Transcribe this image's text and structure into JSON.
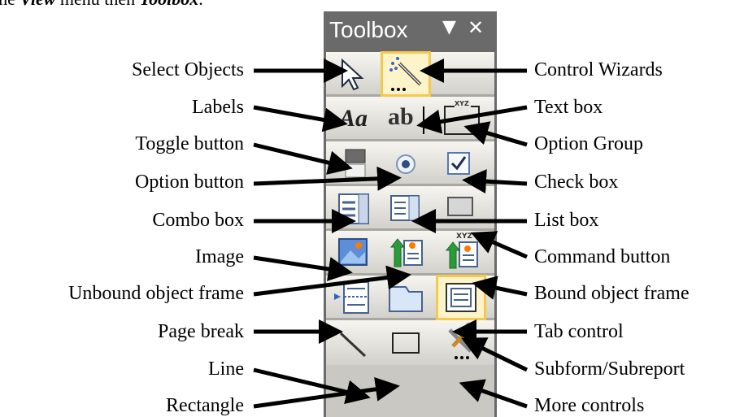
{
  "intro": {
    "text_prefix": "the ",
    "view_word": "View",
    "text_middle": " menu then ",
    "toolbox_word": "Toolbox",
    "text_suffix": "."
  },
  "toolbox": {
    "title": "Toolbox",
    "menu_glyph": "▼",
    "close_glyph": "✕"
  },
  "tools": [
    {
      "id": "select-objects",
      "label": "Select Objects"
    },
    {
      "id": "control-wizards",
      "label": "Control Wizards"
    },
    {
      "id": "labels",
      "label": "Labels",
      "glyph": "Aa"
    },
    {
      "id": "text-box",
      "label": "Text box",
      "glyph": "ab"
    },
    {
      "id": "option-group",
      "label": "Option Group",
      "glyph": "XYZ"
    },
    {
      "id": "toggle-button",
      "label": "Toggle button"
    },
    {
      "id": "option-button",
      "label": "Option button"
    },
    {
      "id": "check-box",
      "label": "Check box"
    },
    {
      "id": "combo-box",
      "label": "Combo box"
    },
    {
      "id": "list-box",
      "label": "List box"
    },
    {
      "id": "command-button",
      "label": "Command button"
    },
    {
      "id": "image",
      "label": "Image"
    },
    {
      "id": "unbound-object-frame",
      "label": "Unbound object frame"
    },
    {
      "id": "bound-object-frame",
      "label": "Bound object frame",
      "glyph": "XYZ"
    },
    {
      "id": "page-break",
      "label": "Page break"
    },
    {
      "id": "tab-control",
      "label": "Tab control"
    },
    {
      "id": "subform-subreport",
      "label": "Subform/Subreport"
    },
    {
      "id": "line",
      "label": "Line"
    },
    {
      "id": "rectangle",
      "label": "Rectangle"
    },
    {
      "id": "more-controls",
      "label": "More controls"
    }
  ]
}
